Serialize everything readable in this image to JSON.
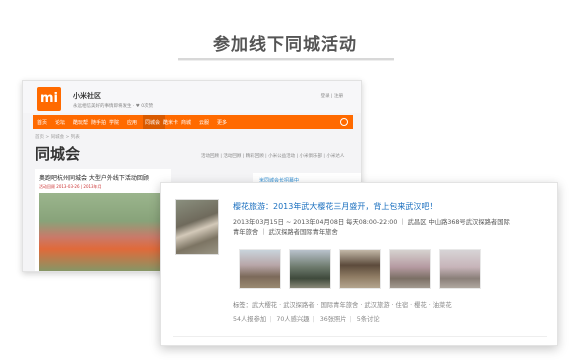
{
  "heading": "参加线下同城活动",
  "back": {
    "logo": "mi",
    "site_name": "小米社区",
    "site_sub": "永远相信美好的事情即将发生 · ♥ 0次赞",
    "site_links": "登录 | 注册",
    "nav": [
      "首页",
      "论坛",
      "酷玩帮",
      "随手拍",
      "学院",
      "应用",
      "同城会",
      "酷米卡",
      "商城",
      "云服",
      "更多"
    ],
    "nav_active": "同城会",
    "breadcrumb": "首页 > 同城会 > 列表",
    "group_title": "同城会",
    "group_links": "活动回顾 | 活动回顾 | 精彩回顾 | 小米公益活动 | 小米俱乐部 | 小米达人",
    "post_title": "奥跑吧杭州同城会 大型户外线下活动回顾",
    "post_meta": "活动回顾 2013-03-26 | 2013年月",
    "side_text": "米同城会长招募中"
  },
  "event": {
    "title": "樱花旅游：2013年武大樱花三月盛开，背上包来武汉吧！",
    "line1": "2013年03月15日 ~ 2013年04月08日 每天08:00-22:00 ｜ 武昌区 中山路368号武汉探路者国际",
    "line2": "青年旅舍 ｜ 武汉探路者国际青年旅舍",
    "tags_label": "标签：",
    "tags": "武大樱花 · 武汉探路者 · 国际青年旅舍 · 武汉旅游 · 住宿 · 樱花 · 油菜花",
    "stats": [
      "54人报参加",
      "70人感兴趣",
      "36张照片",
      "5条讨论"
    ]
  }
}
